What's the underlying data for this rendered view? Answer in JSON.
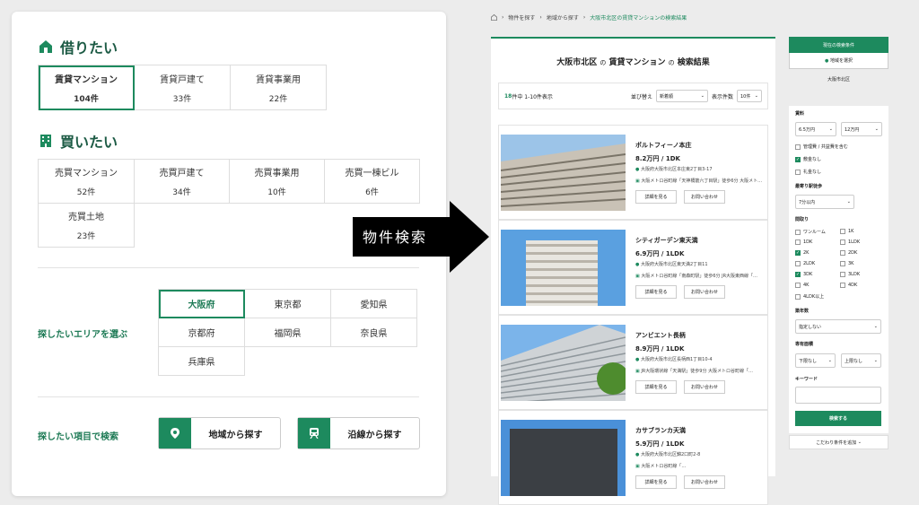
{
  "left": {
    "rent": {
      "title": "借りたい",
      "items": [
        {
          "label": "賃貸マンション",
          "count": "104件"
        },
        {
          "label": "賃貸戸建て",
          "count": "33件"
        },
        {
          "label": "賃貸事業用",
          "count": "22件"
        }
      ]
    },
    "buy": {
      "title": "買いたい",
      "items": [
        {
          "label": "売買マンション",
          "count": "52件"
        },
        {
          "label": "売買戸建て",
          "count": "34件"
        },
        {
          "label": "売買事業用",
          "count": "10件"
        },
        {
          "label": "売買一棟ビル",
          "count": "6件"
        },
        {
          "label": "売買土地",
          "count": "23件"
        }
      ]
    },
    "area_label": "探したいエリアを選ぶ",
    "prefectures": [
      "大阪府",
      "東京都",
      "愛知県",
      "京都府",
      "福岡県",
      "奈良県",
      "兵庫県"
    ],
    "item_label": "探したい項目で検索",
    "search_area": "地域から探す",
    "search_line": "沿線から探す"
  },
  "arrow_label": "物件検索",
  "crumb": [
    "物件を探す",
    "地域から探す",
    "大阪市北区の賃貸マンションの検索結果"
  ],
  "results": {
    "title_a": "大阪市北区",
    "title_b": "の",
    "title_c": "賃貸マンション",
    "title_d": "の",
    "title_e": "検索結果",
    "count": "18",
    "count_text": "件中 1-10件表示",
    "sort_label": "並び替え",
    "sort_value": "新着順",
    "per_label": "表示件数",
    "per_value": "10件",
    "detail_btn": "詳細を見る",
    "contact_btn": "お問い合わせ",
    "items": [
      {
        "name": "ポルトフィーノ本庄",
        "price": "8.2万円 / 1DK",
        "address": "大阪府大阪市北区本庄東2丁目3-17",
        "station": "大阪メトロ谷町線「天神橋筋六丁目駅」徒歩6分 大阪メト…"
      },
      {
        "name": "シティガーデン東天満",
        "price": "6.9万円 / 1LDK",
        "address": "大阪府大阪市北区東天満2丁目11",
        "station": "大阪メトロ谷町線「南森町駅」徒歩6分 JR大阪東西線「…"
      },
      {
        "name": "アンビエント長柄",
        "price": "8.9万円 / 1LDK",
        "address": "大阪府大阪市北区長柄西1丁目10-4",
        "station": "JR大阪環状線「天満駅」徒歩9分 大阪メトロ谷町線「…"
      },
      {
        "name": "カサブランカ天満",
        "price": "5.9万円 / 1LDK",
        "address": "大阪府大阪市北区錦2口町2-8",
        "station": "大阪メトロ谷町線「…"
      }
    ]
  },
  "side": {
    "cur_btn": "現在の検索条件",
    "area_btn": "地域を選択",
    "area_value": "大阪市北区",
    "rent_label": "賃料",
    "rent_min": "6.5万円",
    "rent_max": "12万円",
    "opts": [
      "管理費 / 共益費を含む",
      "敷金なし",
      "礼金なし"
    ],
    "walk_label": "最寄り駅徒歩",
    "walk_value": "7分以内",
    "layout_label": "間取り",
    "layouts": [
      "ワンルーム",
      "1K",
      "1DK",
      "1LDK",
      "2K",
      "2DK",
      "2LDK",
      "3K",
      "3DK",
      "3LDK",
      "4K",
      "4DK",
      "4LDK以上"
    ],
    "age_label": "築年数",
    "age_value": "指定しない",
    "floor_label": "専有面積",
    "floor_min": "下限なし",
    "floor_max": "上限なし",
    "kw_label": "キーワード",
    "search_btn": "検索する",
    "more_btn": "こだわり条件を追加"
  },
  "colors": {
    "accent": "#1d8a5e"
  }
}
